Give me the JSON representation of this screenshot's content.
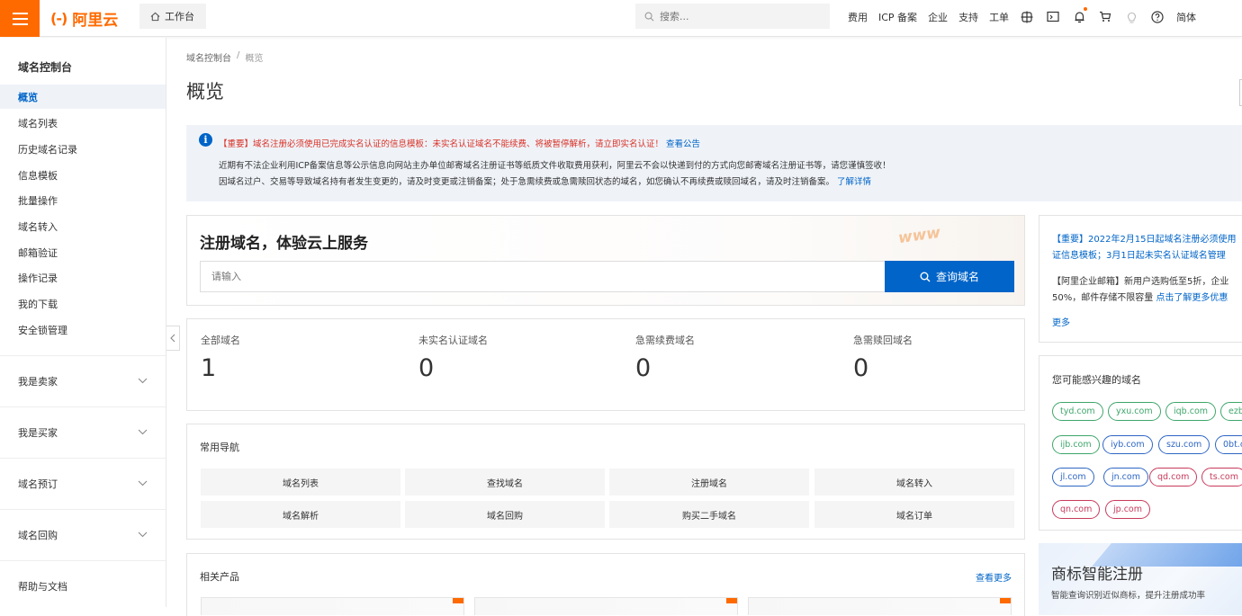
{
  "topbar": {
    "brand": "阿里云",
    "brand_mark": "(-)",
    "workbench_label": "工作台",
    "search_placeholder": "搜索...",
    "links": [
      "费用",
      "ICP 备案",
      "企业",
      "支持",
      "工单"
    ],
    "lang": "简体"
  },
  "sidebar": {
    "title": "域名控制台",
    "items": [
      {
        "label": "概览",
        "active": true
      },
      {
        "label": "域名列表"
      },
      {
        "label": "历史域名记录"
      },
      {
        "label": "信息模板"
      },
      {
        "label": "批量操作"
      },
      {
        "label": "域名转入"
      },
      {
        "label": "邮箱验证"
      },
      {
        "label": "操作记录"
      },
      {
        "label": "我的下载"
      },
      {
        "label": "安全锁管理"
      }
    ],
    "groups": [
      "我是卖家",
      "我是买家",
      "域名预订",
      "域名回购"
    ],
    "help": "帮助与文档"
  },
  "breadcrumb": {
    "root": "域名控制台",
    "sep": "/",
    "current": "概览"
  },
  "page_title": "概览",
  "notice": {
    "important": "【重要】域名注册必须使用已完成实名认证的信息模板：未实名认证域名不能续费、将被暂停解析，请立即实名认证！",
    "important_link": "查看公告",
    "line2": "近期有不法企业利用ICP备案信息等公示信息向网站主办单位邮寄域名注册证书等纸质文件收取费用获利，阿里云不会以快递到付的方式向您邮寄域名注册证书等，请您谨慎签收！",
    "line3": "因域名过户、交易等导致域名持有者发生变更的，请及时变更或注销备案；处于急需续费或急需赎回状态的域名，如您确认不再续费或赎回域名，请及时注销备案。",
    "line3_link": "了解详情"
  },
  "register": {
    "title": "注册域名，体验云上服务",
    "input_placeholder": "请输入",
    "button": "查询域名",
    "deco": "www"
  },
  "stats": [
    {
      "label": "全部域名",
      "value": "1"
    },
    {
      "label": "未实名认证域名",
      "value": "0"
    },
    {
      "label": "急需续费域名",
      "value": "0"
    },
    {
      "label": "急需赎回域名",
      "value": "0"
    }
  ],
  "quick_nav": {
    "title": "常用导航",
    "items": [
      "域名列表",
      "查找域名",
      "注册域名",
      "域名转入",
      "域名解析",
      "域名回购",
      "购买二手域名",
      "域名订单"
    ]
  },
  "related": {
    "title": "相关产品",
    "more": "查看更多"
  },
  "news": {
    "line1a": "【重要】2022年2月15日起域名注册必须使用",
    "line1b": "证信息模板；3月1日起未实名认证域名管理",
    "line2a": "【阿里企业邮箱】新用户选购低至5折，企业",
    "line2b": "50%，邮件存储不限容量",
    "line2_link": "点击了解更多优惠",
    "more": "更多"
  },
  "interest": {
    "title": "您可能感兴趣的域名",
    "tags": [
      {
        "text": "tyd.com",
        "color": "green"
      },
      {
        "text": "yxu.com",
        "color": "green"
      },
      {
        "text": "iqb.com",
        "color": "green"
      },
      {
        "text": "ezb",
        "color": "green"
      },
      {
        "text": "ijb.com",
        "color": "green"
      },
      {
        "text": "iyb.com",
        "color": "blue"
      },
      {
        "text": "szu.com",
        "color": "blue"
      },
      {
        "text": "0bt.c",
        "color": "blue"
      },
      {
        "text": "jl.com",
        "color": "blue"
      },
      {
        "text": "jn.com",
        "color": "blue"
      },
      {
        "text": "qd.com",
        "color": "red"
      },
      {
        "text": "ts.com",
        "color": "red"
      },
      {
        "text": "qn.com",
        "color": "red"
      },
      {
        "text": "jp.com",
        "color": "red"
      }
    ]
  },
  "trademark": {
    "title": "商标智能注册",
    "sub": "智能查询识别近似商标，提升注册成功率"
  },
  "colors": {
    "accent": "#ff6a00",
    "primary": "#0064c8",
    "notice_bg": "#eff3f8"
  }
}
